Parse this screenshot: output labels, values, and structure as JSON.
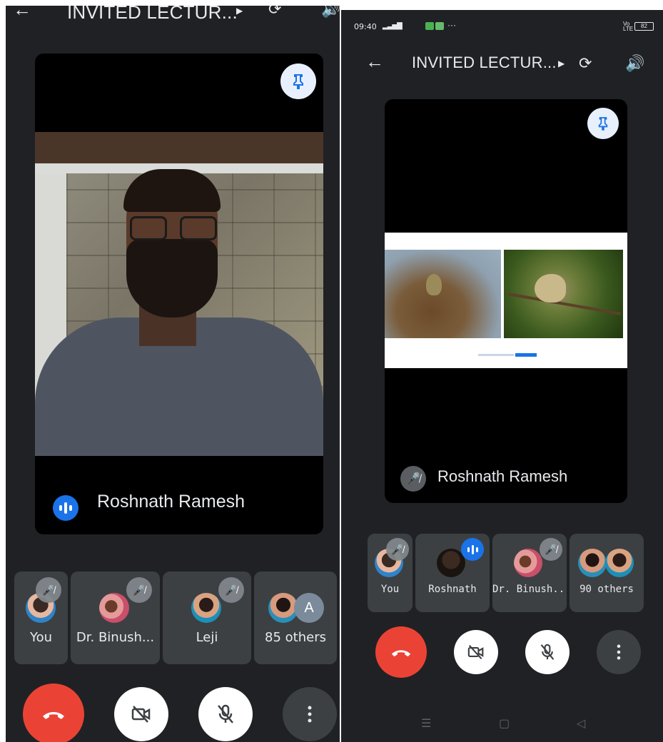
{
  "left": {
    "meeting_title": "INVITED LECTUR...",
    "presenter_name": "Roshnath Ramesh",
    "participants": [
      {
        "label": "You"
      },
      {
        "label": "Dr. Binush..."
      },
      {
        "label": "Leji"
      },
      {
        "label": "85 others",
        "avatar_letter": "A"
      }
    ]
  },
  "right": {
    "status": {
      "time": "09:40",
      "lte": "Vo\nLTE",
      "battery": "82",
      "more": "···"
    },
    "meeting_title": "INVITED LECTUR...",
    "presenter_name": "Roshnath Ramesh",
    "participants": [
      {
        "label": "You"
      },
      {
        "label": "Roshnath"
      },
      {
        "label": "Dr. Binush..."
      },
      {
        "label": "90 others"
      }
    ]
  },
  "colors": {
    "background": "#202124",
    "tile": "#3c4043",
    "accent": "#1a73e8",
    "end_call": "#ea4335"
  },
  "icons": [
    "back-arrow-icon",
    "caret-right-icon",
    "rotate-camera-icon",
    "speaker-icon",
    "pin-icon",
    "mic-off-icon",
    "speaking-icon",
    "end-call-icon",
    "camera-off-icon",
    "more-vert-icon"
  ]
}
